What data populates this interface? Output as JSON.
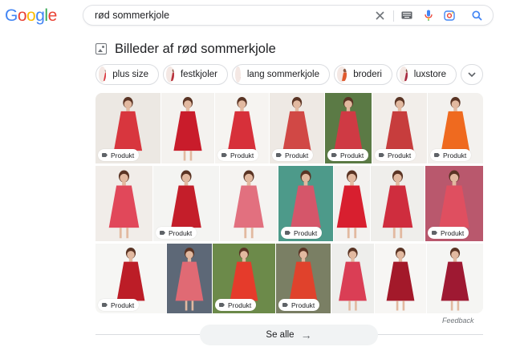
{
  "logo": {
    "letters": [
      "G",
      "o",
      "o",
      "g",
      "l",
      "e"
    ],
    "colors": [
      "#4285f4",
      "#ea4335",
      "#fbbc05",
      "#4285f4",
      "#34a853",
      "#ea4335"
    ]
  },
  "search": {
    "query": "rød sommerkjole"
  },
  "section": {
    "title": "Billeder af rød sommerkjole"
  },
  "chips": [
    {
      "label": "plus size",
      "color": "#d9343b"
    },
    {
      "label": "festkjoler",
      "color": "#b8323c"
    },
    {
      "label": "lang sommerkjole",
      "color": "#c52a35"
    },
    {
      "label": "broderi",
      "color": "#e05a2e"
    },
    {
      "label": "luxstore",
      "color": "#a82a40"
    }
  ],
  "tag_label": "Produkt",
  "tiles": [
    {
      "bg": "#ece8e3",
      "dress": "#d8363e",
      "tag": true
    },
    {
      "bg": "#f4f2ef",
      "dress": "#c91c2b",
      "tag": false
    },
    {
      "bg": "#f6f4f1",
      "dress": "#d7303a",
      "tag": true
    },
    {
      "bg": "#eee9e4",
      "dress": "#d14845",
      "tag": true
    },
    {
      "bg": "#5b7a45",
      "dress": "#cf3a44",
      "tag": true
    },
    {
      "bg": "#f2eeea",
      "dress": "#c73d3d",
      "tag": true
    },
    {
      "bg": "#f3f1ee",
      "dress": "#ef6a1f",
      "tag": true
    },
    {
      "bg": "#f1ede9",
      "dress": "#e1485a",
      "tag": false
    },
    {
      "bg": "#f4f4f2",
      "dress": "#c41e2a",
      "tag": true
    },
    {
      "bg": "#f5f3f1",
      "dress": "#e2707f",
      "tag": false
    },
    {
      "bg": "#4d9a8a",
      "dress": "#d5566a",
      "tag": true
    },
    {
      "bg": "#f3f1ef",
      "dress": "#d81f2f",
      "tag": false
    },
    {
      "bg": "#efeeeb",
      "dress": "#cf2d3e",
      "tag": false
    },
    {
      "bg": "#b9586d",
      "dress": "#df4f60",
      "tag": true
    },
    {
      "bg": "#f6f6f4",
      "dress": "#bc1d27",
      "tag": true
    },
    {
      "bg": "#5d6877",
      "dress": "#e06a74",
      "tag": false
    },
    {
      "bg": "#6c8a4a",
      "dress": "#e53b2b",
      "tag": true
    },
    {
      "bg": "#7a7f64",
      "dress": "#e0422c",
      "tag": true
    },
    {
      "bg": "#eeeeec",
      "dress": "#da3e55",
      "tag": false
    },
    {
      "bg": "#f7f6f4",
      "dress": "#a3192a",
      "tag": false
    },
    {
      "bg": "#f5f5f3",
      "dress": "#9e1932",
      "tag": false
    }
  ],
  "feedback": "Feedback",
  "see_all": "Se alle"
}
